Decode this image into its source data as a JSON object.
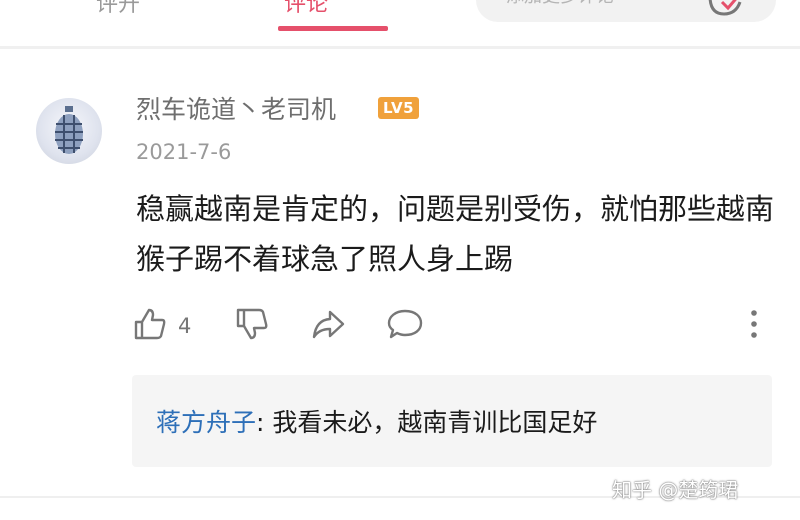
{
  "tabs": {
    "left_label": "评开",
    "active_label": "评论"
  },
  "search": {
    "text": "添加更多评论"
  },
  "comment": {
    "username": "烈车诡道丶老司机",
    "level": "LV5",
    "date": "2021-7-6",
    "content": "稳赢越南是肯定的，问题是别受伤，就怕那些越南猴子踢不着球急了照人身上踢",
    "like_count": "4"
  },
  "reply": {
    "author": "蒋方舟子",
    "colon": ":",
    "text": "我看未必，越南青训比国足好"
  },
  "watermark": "知乎 @楚筠珺",
  "icons": [
    "check-icon",
    "thumbs-up-icon",
    "thumbs-down-icon",
    "share-icon",
    "comment-icon",
    "more-icon"
  ],
  "colors": {
    "accent": "#e5506b",
    "reply_author": "#2d6fb8",
    "level_badge": "#f0a13b"
  }
}
